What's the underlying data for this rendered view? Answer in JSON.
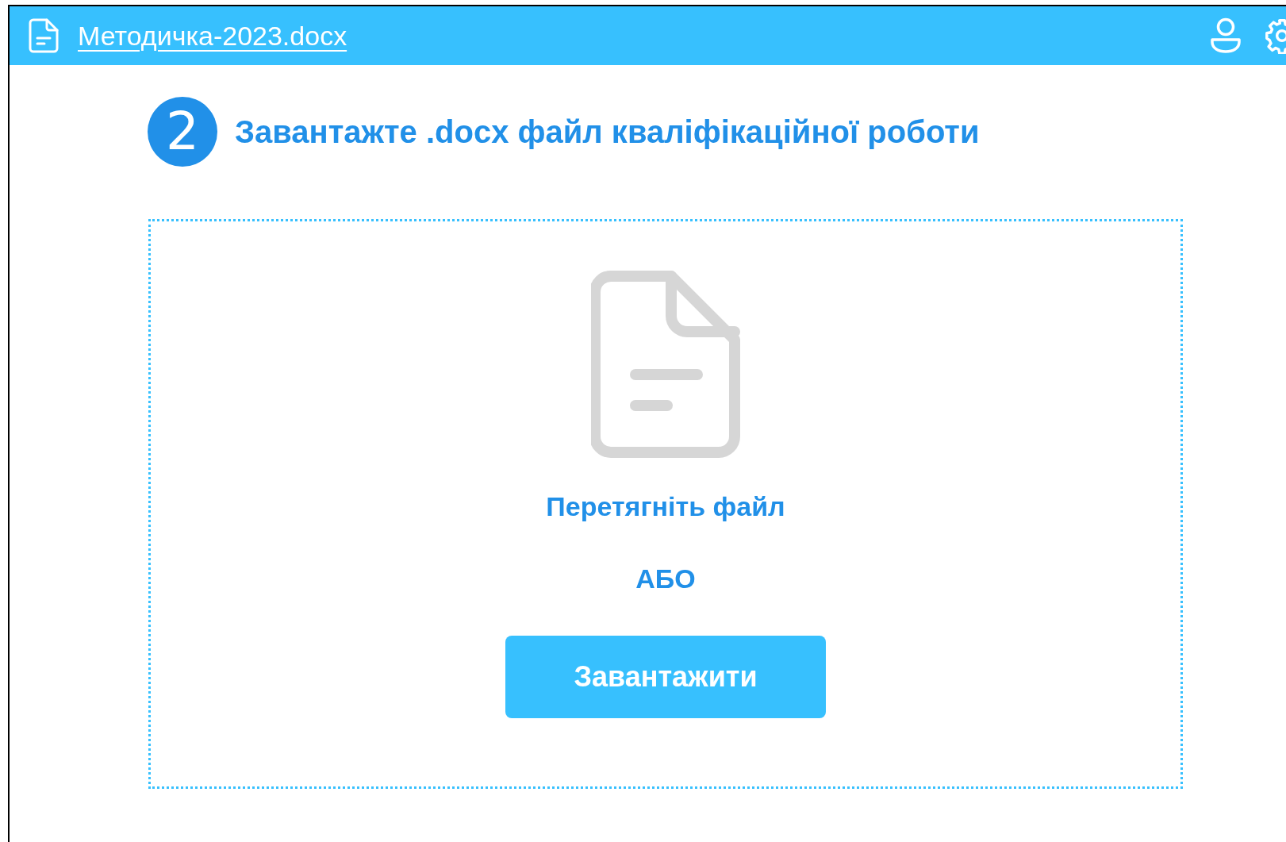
{
  "header": {
    "file_name": "Методичка-2023.docx"
  },
  "step": {
    "number": "2",
    "title": "Завантажте .docx файл кваліфікаційної роботи"
  },
  "dropzone": {
    "hint": "Перетягніть файл",
    "separator": "АБО",
    "button": "Завантажити"
  }
}
